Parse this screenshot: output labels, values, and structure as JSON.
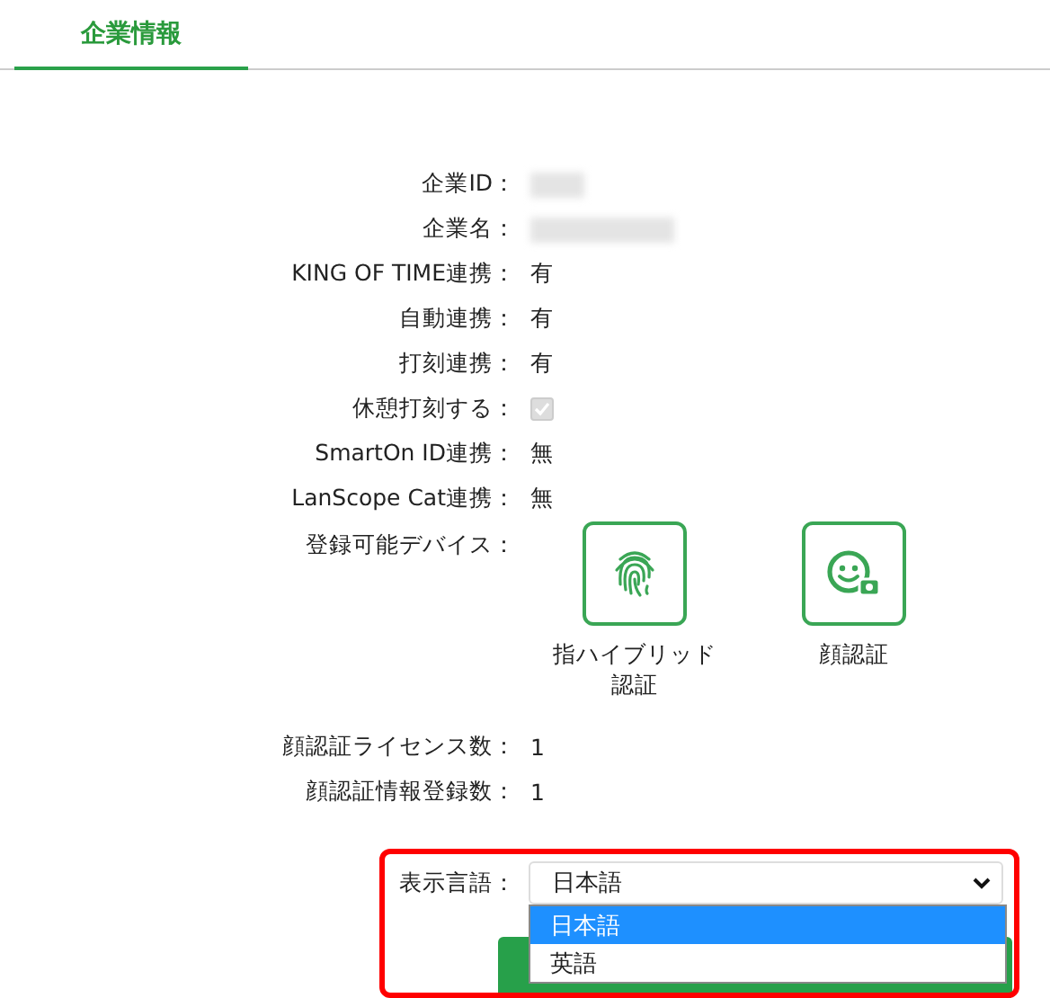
{
  "tabs": [
    {
      "label": "企業情報",
      "selected": true
    }
  ],
  "fields": [
    {
      "kind": "redacted",
      "label": "企業ID："
    },
    {
      "kind": "redacted",
      "label": "企業名："
    },
    {
      "kind": "text",
      "label": "KING OF TIME連携：",
      "value": "有"
    },
    {
      "kind": "text",
      "label": "自動連携：",
      "value": "有"
    },
    {
      "kind": "text",
      "label": "打刻連携：",
      "value": "有"
    },
    {
      "kind": "checkbox",
      "label": "休憩打刻する：",
      "checked": true,
      "disabled": true
    },
    {
      "kind": "text",
      "label": "SmartOn ID連携：",
      "value": "無"
    },
    {
      "kind": "text",
      "label": "LanScope Cat連携：",
      "value": "無"
    }
  ],
  "devices": {
    "label": "登録可能デバイス：",
    "items": [
      {
        "kind": "fingerprint",
        "label": "指ハイブリッド認証"
      },
      {
        "kind": "face",
        "label": "顔認証"
      }
    ]
  },
  "counts": [
    {
      "label": "顔認証ライセンス数：",
      "value": "1"
    },
    {
      "label": "顔認証情報登録数：",
      "value": "1"
    }
  ],
  "language": {
    "label": "表示言語：",
    "value": "日本語",
    "highlighted": true,
    "expanded": true,
    "options": [
      {
        "label": "日本語",
        "selected": true
      },
      {
        "label": "英語",
        "selected": false
      }
    ]
  }
}
